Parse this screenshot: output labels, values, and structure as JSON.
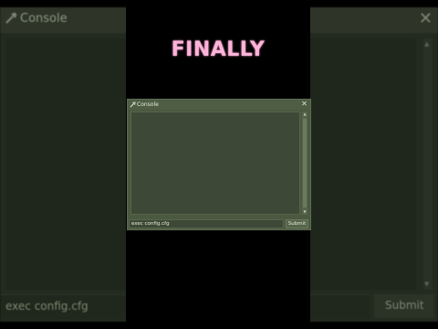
{
  "caption": "FINALLY",
  "console": {
    "title": "Console",
    "input_value": "exec config.cfg",
    "submit_label": "Submit",
    "close_glyph": "✕",
    "scroll_up_glyph": "▲",
    "scroll_down_glyph": "▼"
  },
  "background_console": {
    "title": "Console",
    "input_value": "exec config.cfg",
    "submit_label": "Submit",
    "close_glyph": "✕"
  },
  "colors": {
    "window_bg": "#4a5940",
    "log_bg": "#3d4936",
    "caption": "#ffb3d9"
  },
  "icons": {
    "title_icon": "gear-icon",
    "close_icon": "close-icon"
  }
}
